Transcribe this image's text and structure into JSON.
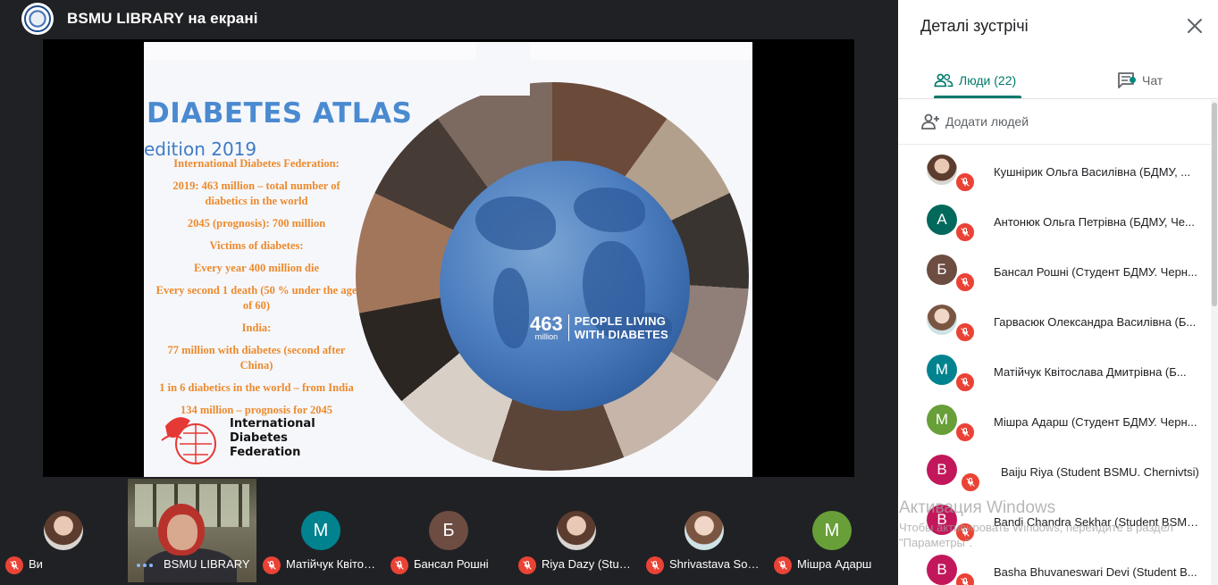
{
  "header": {
    "title": "BSMU LIBRARY на екрані"
  },
  "slide": {
    "title": "DIABETES ATLAS",
    "edition": "edition 2019",
    "paragraphs": [
      "International Diabetes Federation:",
      "2019: 463 million – total number of diabetics in the world",
      "2045 (prognosis): 700 million",
      "Victims of diabetes:",
      "Every year 400 million die",
      "Every second 1 death (50 % under the age of 60)",
      "India:",
      "77 million with diabetes (second after China)",
      "1 in 6 diabetics in the world – from India",
      "134 million – prognosis for 2045"
    ],
    "globe_number": "463",
    "globe_unit": "million",
    "globe_label_1": "PEOPLE LIVING",
    "globe_label_2": "WITH DIABETES",
    "org_name_1": "International",
    "org_name_2": "Diabetes",
    "org_name_3": "Federation"
  },
  "filmstrip": [
    {
      "name": "Ви",
      "initial": "",
      "color": "",
      "type": "photo"
    },
    {
      "name": "BSMU LIBRARY",
      "initial": "",
      "color": "",
      "type": "video"
    },
    {
      "name": "Матійчук Квітослава",
      "initial": "M",
      "color": "#00838f",
      "type": "initial"
    },
    {
      "name": "Бансал Рошні",
      "initial": "Б",
      "color": "#6d4c41",
      "type": "initial"
    },
    {
      "name": "Riya Dazy (Student)",
      "initial": "",
      "color": "",
      "type": "photo"
    },
    {
      "name": "Shrivastava Sonali",
      "initial": "",
      "color": "",
      "type": "photo"
    },
    {
      "name": "Мішра Адарш",
      "initial": "M",
      "color": "#689f38",
      "type": "initial"
    }
  ],
  "panel": {
    "title": "Деталі зустрічі",
    "tab_people": "Люди (22)",
    "tab_chat": "Чат",
    "add_people": "Додати людей",
    "participants": [
      {
        "name": "Кушнірик Ольга Василівна (БДМУ, ...",
        "initial": "",
        "color": "",
        "type": "photo"
      },
      {
        "name": "Антонюк Ольга Петрівна (БДМУ, Че...",
        "initial": "A",
        "color": "#00695c",
        "type": "initial"
      },
      {
        "name": "Бансал Рошні (Студент БДМУ. Черн...",
        "initial": "Б",
        "color": "#6d4c41",
        "type": "initial"
      },
      {
        "name": "Гарвасюк Олександра Василівна (Б...",
        "initial": "",
        "color": "",
        "type": "photo"
      },
      {
        "name": "Матійчук Квітослава Дмитрівна (Б...",
        "initial": "M",
        "color": "#00838f",
        "type": "initial"
      },
      {
        "name": "Мішра Адарш (Студент БДМУ. Черн...",
        "initial": "M",
        "color": "#689f38",
        "type": "initial"
      },
      {
        "name": "Baiju Riya (Student BSMU. Chernivtsi)",
        "initial": "B",
        "color": "#c2185b",
        "type": "initial"
      },
      {
        "name": "Bandi Chandra Sekhar (Student BSMU...",
        "initial": "B",
        "color": "#c2185b",
        "type": "initial"
      },
      {
        "name": "Basha Bhuvaneswari Devi (Student B...",
        "initial": "B",
        "color": "#c2185b",
        "type": "initial"
      }
    ]
  },
  "watermark": {
    "title": "Активация Windows",
    "subtitle": "Чтобы активировать Windows, перейдите в раздел \"Параметры\"."
  },
  "colors": {
    "accent": "#00796b",
    "mic_off": "#ea4335",
    "slide_text": "#ec8a2c",
    "slide_title": "#4a8ad0"
  }
}
